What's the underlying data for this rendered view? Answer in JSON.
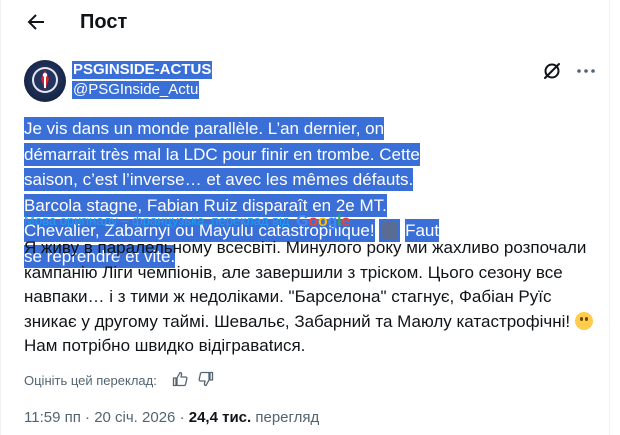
{
  "header": {
    "title": "Пост"
  },
  "author": {
    "name": "PSGINSIDE-ACTUS",
    "handle": "@PSGInside_Actu"
  },
  "tweet": {
    "original_part1": "Je vis dans un monde parallèle. L’an dernier, on démarrait très mal la LDC pour finir en trombe. Cette saison, c’est l’inverse… et avec les mêmes défauts. Barcola stagne, Fabian Ruiz disparaît en 2e MT. Chevalier, Zabarnyi ou Mayulu catastrophique!",
    "original_part2": "Faut se reprendre et vite.",
    "translated_by_label": "Мова оригіналу – французька, переклад від",
    "translation_text": "Я живу в паралельному всесвіті. Минулого року ми жахливо розпочали кампанію Ліги чемпіонів, але завершили з тріском. Цього сезону все навпаки… і з тими ж недоліками. \"Барселона\" стагнує, Фабіан Руїс зникає у другому таймі. Шевальє, Забарний та Маюлу катастрофічні!",
    "translation_end": "Нам потрібно швидко відігравatися."
  },
  "rate": {
    "label": "Оцініть цей переклад:"
  },
  "meta": {
    "time": "11:59 пп",
    "date": "20 січ. 2026",
    "views_count": "24,4 тис.",
    "views_label": "перегляд"
  },
  "colors": {
    "selection": "#3a6fd8",
    "link": "#1d9bf0",
    "muted": "#536471",
    "text": "#0f1419"
  }
}
